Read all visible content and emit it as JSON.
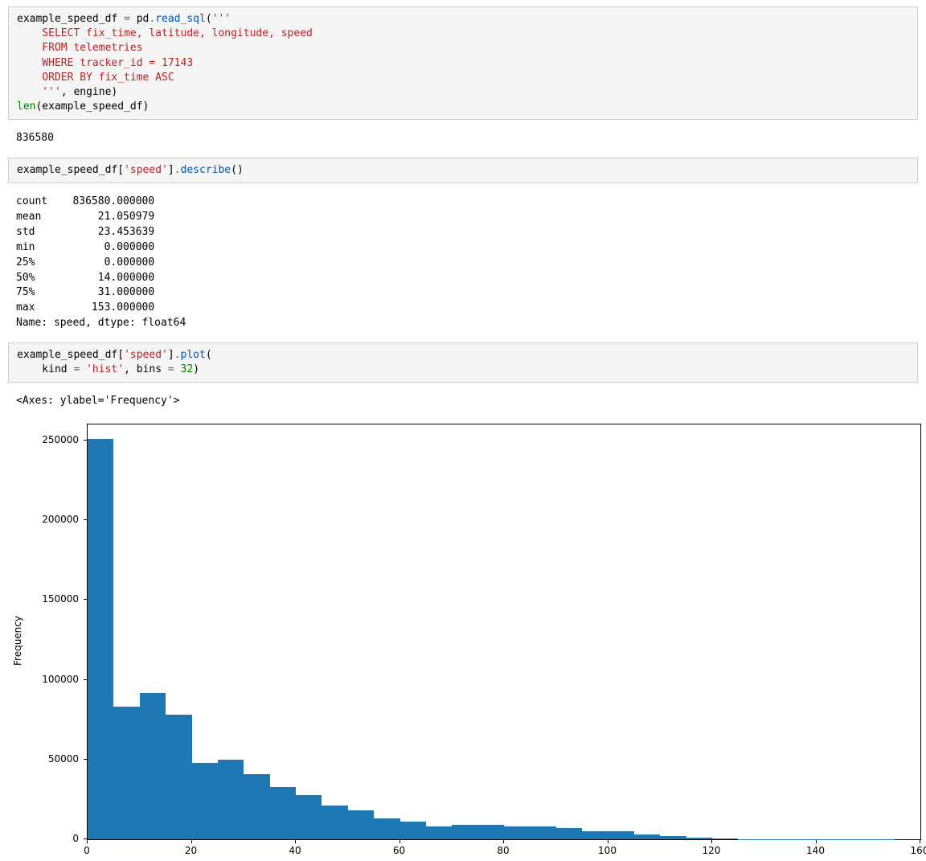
{
  "code_cells": {
    "cell1": {
      "line1_a": "example_speed_df ",
      "line1_b": "=",
      "line1_c": " pd",
      "line1_d": ".",
      "line1_e": "read_sql",
      "line1_f": "(",
      "line1_g": "'''",
      "line2": "    SELECT fix_time, latitude, longitude, speed",
      "line3": "    FROM telemetries",
      "line4": "    WHERE tracker_id = 17143",
      "line5": "    ORDER BY fix_time ASC",
      "line6a": "    '''",
      "line6b": ", engine)",
      "line7a": "len",
      "line7b": "(example_speed_df)"
    },
    "cell2": {
      "a": "example_speed_df[",
      "b": "'speed'",
      "c": "]",
      "d": ".",
      "e": "describe",
      "f": "()"
    },
    "cell3": {
      "l1a": "example_speed_df[",
      "l1b": "'speed'",
      "l1c": "]",
      "l1d": ".",
      "l1e": "plot",
      "l1f": "(",
      "l2a": "    kind ",
      "l2b": "=",
      "l2c": " ",
      "l2d": "'hist'",
      "l2e": ", bins ",
      "l2f": "=",
      "l2g": " ",
      "l2h": "32",
      "l2i": ")"
    }
  },
  "outputs": {
    "out1": "836580",
    "out2": "count    836580.000000\nmean         21.050979\nstd          23.453639\nmin           0.000000\n25%           0.000000\n50%          14.000000\n75%          31.000000\nmax         153.000000\nName: speed, dtype: float64",
    "out3": "<Axes: ylabel='Frequency'>"
  },
  "chart_data": {
    "type": "bar",
    "title": "",
    "xlabel": "",
    "ylabel": "Frequency",
    "xlim": [
      0,
      160
    ],
    "ylim": [
      0,
      260000
    ],
    "xticks": [
      0,
      20,
      40,
      60,
      80,
      100,
      120,
      140,
      160
    ],
    "yticks": [
      0,
      50000,
      100000,
      150000,
      200000,
      250000
    ],
    "bin_edges": [
      0,
      5,
      10,
      15,
      20,
      25,
      30,
      35,
      40,
      45,
      50,
      55,
      60,
      65,
      70,
      75,
      80,
      85,
      90,
      95,
      100,
      105,
      110,
      115,
      120,
      125,
      130,
      135,
      140,
      145,
      150,
      155,
      160
    ],
    "values": [
      251000,
      83000,
      92000,
      78000,
      48000,
      50000,
      41000,
      33000,
      28000,
      21000,
      18000,
      13000,
      11000,
      8000,
      9000,
      9000,
      8000,
      8000,
      7000,
      5000,
      5000,
      3000,
      2000,
      1000,
      800,
      200,
      200,
      200,
      200,
      200,
      200,
      0
    ]
  }
}
